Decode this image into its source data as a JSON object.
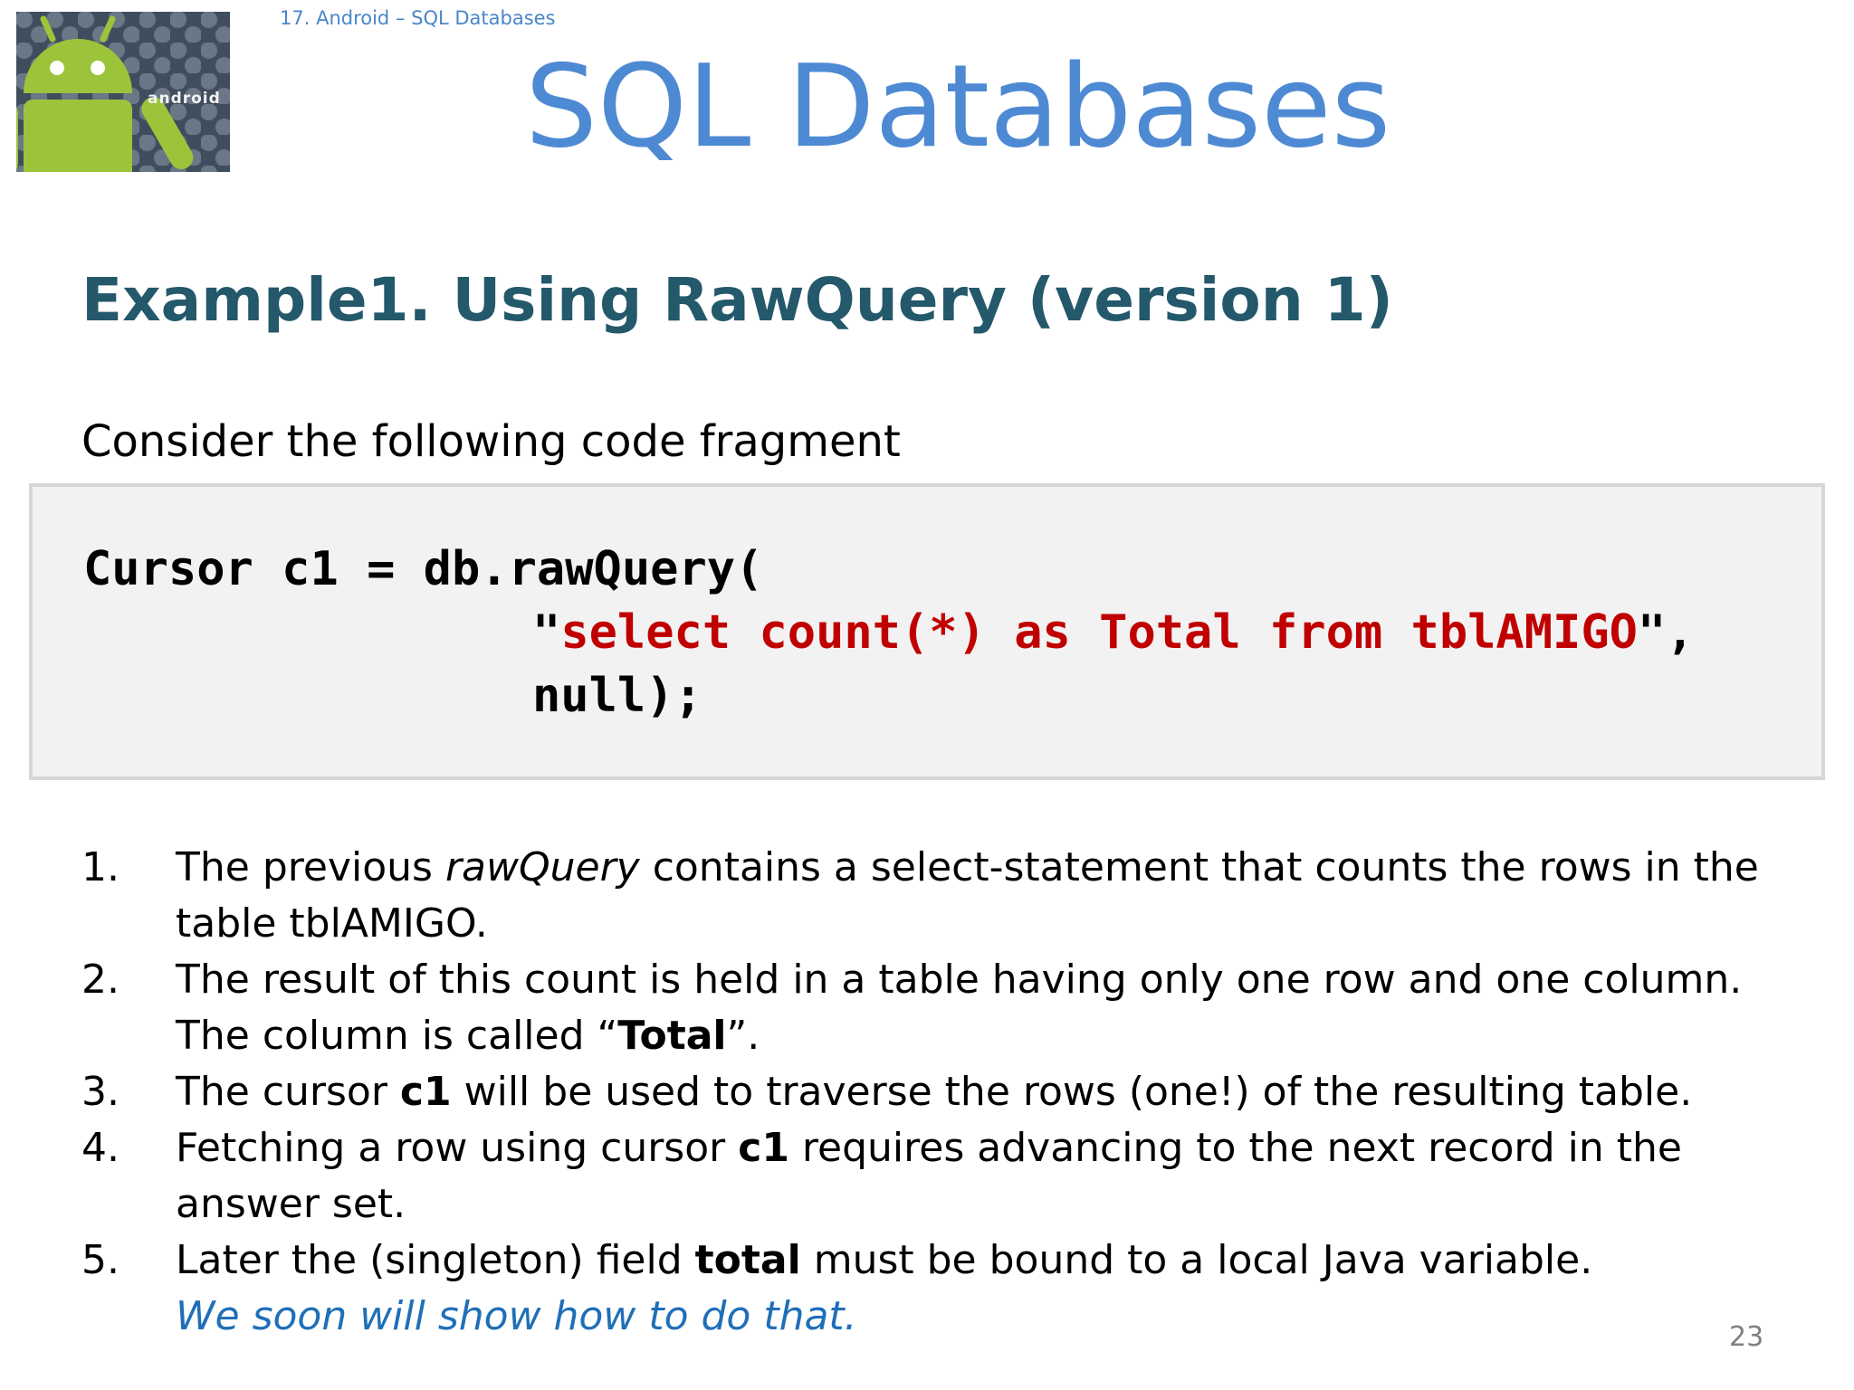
{
  "header": {
    "breadcrumb": "17. Android – SQL Databases",
    "logo_text": "android",
    "title": "SQL Databases"
  },
  "section": {
    "title": "Example1. Using RawQuery (version 1)",
    "intro": "Consider the following code fragment"
  },
  "code": {
    "line1": "Cursor c1 = db.rawQuery(",
    "line2_quote_open": "\"",
    "line2_string": "select count(*) as Total from tblAMIGO",
    "line2_tail": "\",",
    "line3": "null);"
  },
  "points": [
    {
      "num": "1.",
      "before": "The previous ",
      "italic": "rawQuery",
      "after": " contains a select-statement that counts the rows in the table tblAMIGO."
    },
    {
      "num": "2.",
      "before": "The result of this count is held in a table having only one row and one column. The column is called “",
      "bold": "Total",
      "after": "”."
    },
    {
      "num": "3.",
      "before": "The cursor ",
      "bold": "c1",
      "after": " will be used to traverse the rows (one!) of the resulting table."
    },
    {
      "num": "4.",
      "before": "Fetching a row using cursor ",
      "bold": "c1",
      "after": " requires advancing to the next record in the answer set."
    },
    {
      "num": "5.",
      "before": "Later the (singleton) field ",
      "bold": "total",
      "after": " must be bound to a local Java variable.",
      "note": "We soon will show how to do that."
    }
  ],
  "footer": {
    "page_number": "23"
  },
  "colors": {
    "title_blue": "#4e8ad3",
    "heading_teal": "#24586b",
    "code_string_red": "#c00000",
    "note_blue": "#1f6fb8",
    "android_green": "#9bc43b"
  },
  "icons": {
    "logo": "android-robot-icon"
  }
}
